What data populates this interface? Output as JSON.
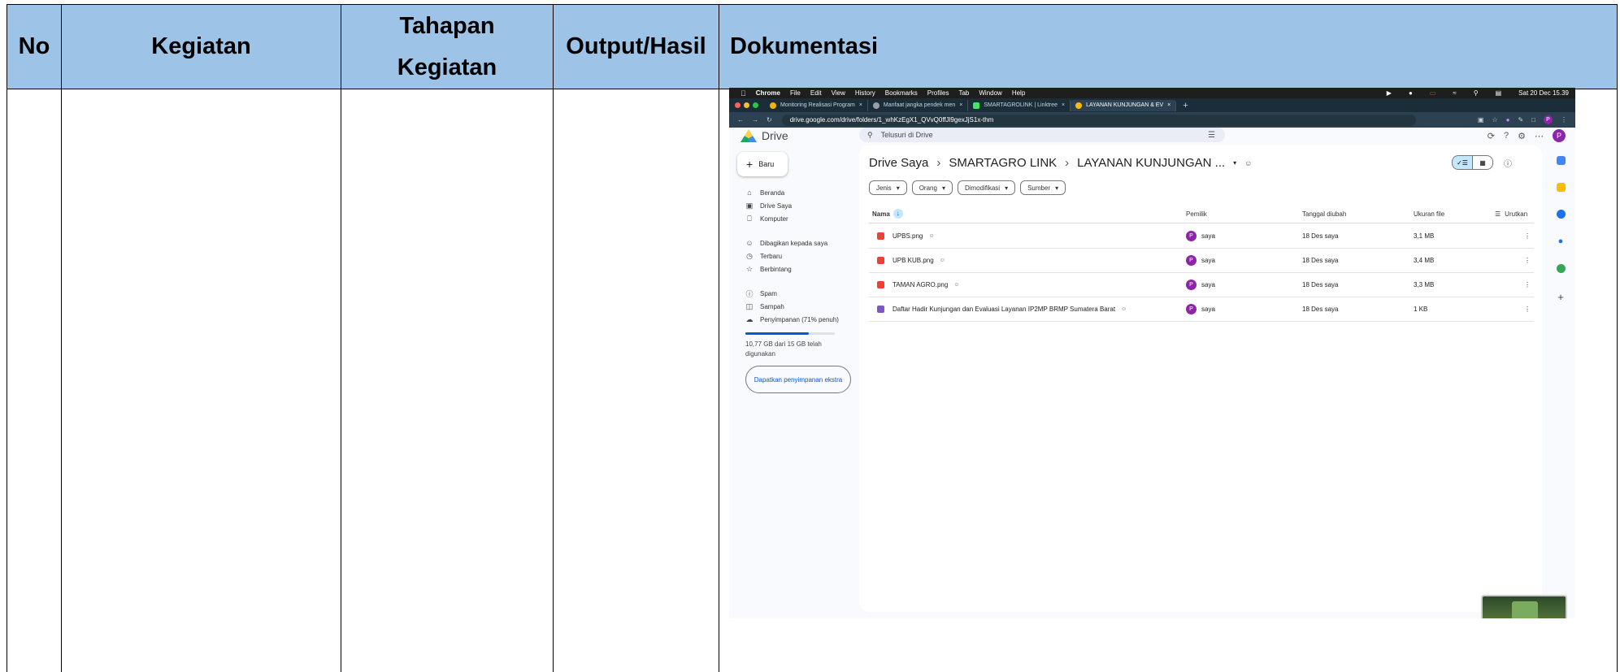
{
  "table": {
    "headers": [
      "No",
      "Kegiatan",
      "Tahapan Kegiatan",
      "Output/Hasil",
      "Dokumentasi"
    ],
    "header_bg": "#9dc3e6"
  },
  "screenshot": {
    "menubar": {
      "app": "Chrome",
      "menus": [
        "File",
        "Edit",
        "View",
        "History",
        "Bookmarks",
        "Profiles",
        "Tab",
        "Window",
        "Help"
      ],
      "clock": "Sat 20 Dec  15.39"
    },
    "tabs": [
      {
        "title": "Monitoring Realisasi Program",
        "color": "#f4b400"
      },
      {
        "title": "Manfaat jangka pendek men",
        "color": "#9aa0a6"
      },
      {
        "title": "SMARTAGROLINK | Linktree",
        "color": "#43e660"
      },
      {
        "title": "LAYANAN KUNJUNGAN & EV",
        "color": "#fbbc04"
      }
    ],
    "url": "drive.google.com/drive/folders/1_whKzEgX1_QVvQ0ffJl9gexJjS1x-thm",
    "drive": {
      "logo_text": "Drive",
      "search_placeholder": "Telusuri di Drive",
      "new_label": "Baru",
      "nav": [
        "Beranda",
        "Drive Saya",
        "Komputer",
        "Dibagikan kepada saya",
        "Terbaru",
        "Berbintang",
        "Spam",
        "Sampah",
        "Penyimpanan (71% penuh)"
      ],
      "storage_used": 0.71,
      "storage_text": "10,77 GB dari 15 GB telah digunakan",
      "get_storage": "Dapatkan penyimpanan ekstra",
      "avatar_letter": "P",
      "breadcrumb": [
        "Drive Saya",
        "SMARTAGRO LINK",
        "LAYANAN KUNJUNGAN ..."
      ],
      "filters": [
        "Jenis",
        "Orang",
        "Dimodifikasi",
        "Sumber"
      ],
      "columns": [
        "Nama",
        "Pemilik",
        "Tanggal diubah",
        "Ukuran file",
        "Urutkan"
      ],
      "files": [
        {
          "name": "UPBS.png",
          "owner": "saya",
          "date": "18 Des saya",
          "size": "3,1 MB",
          "icon_color": "#ea4335"
        },
        {
          "name": "UPB KUB.png",
          "owner": "saya",
          "date": "18 Des saya",
          "size": "3,4 MB",
          "icon_color": "#ea4335"
        },
        {
          "name": "TAMAN AGRO.png",
          "owner": "saya",
          "date": "18 Des saya",
          "size": "3,3 MB",
          "icon_color": "#ea4335"
        },
        {
          "name": "Daftar Hadir Kunjungan dan Evaluasi Layanan IP2MP BRMP Sumatera Barat",
          "owner": "saya",
          "date": "18 Des saya",
          "size": "1 KB",
          "icon_color": "#7e57c2"
        }
      ]
    }
  }
}
